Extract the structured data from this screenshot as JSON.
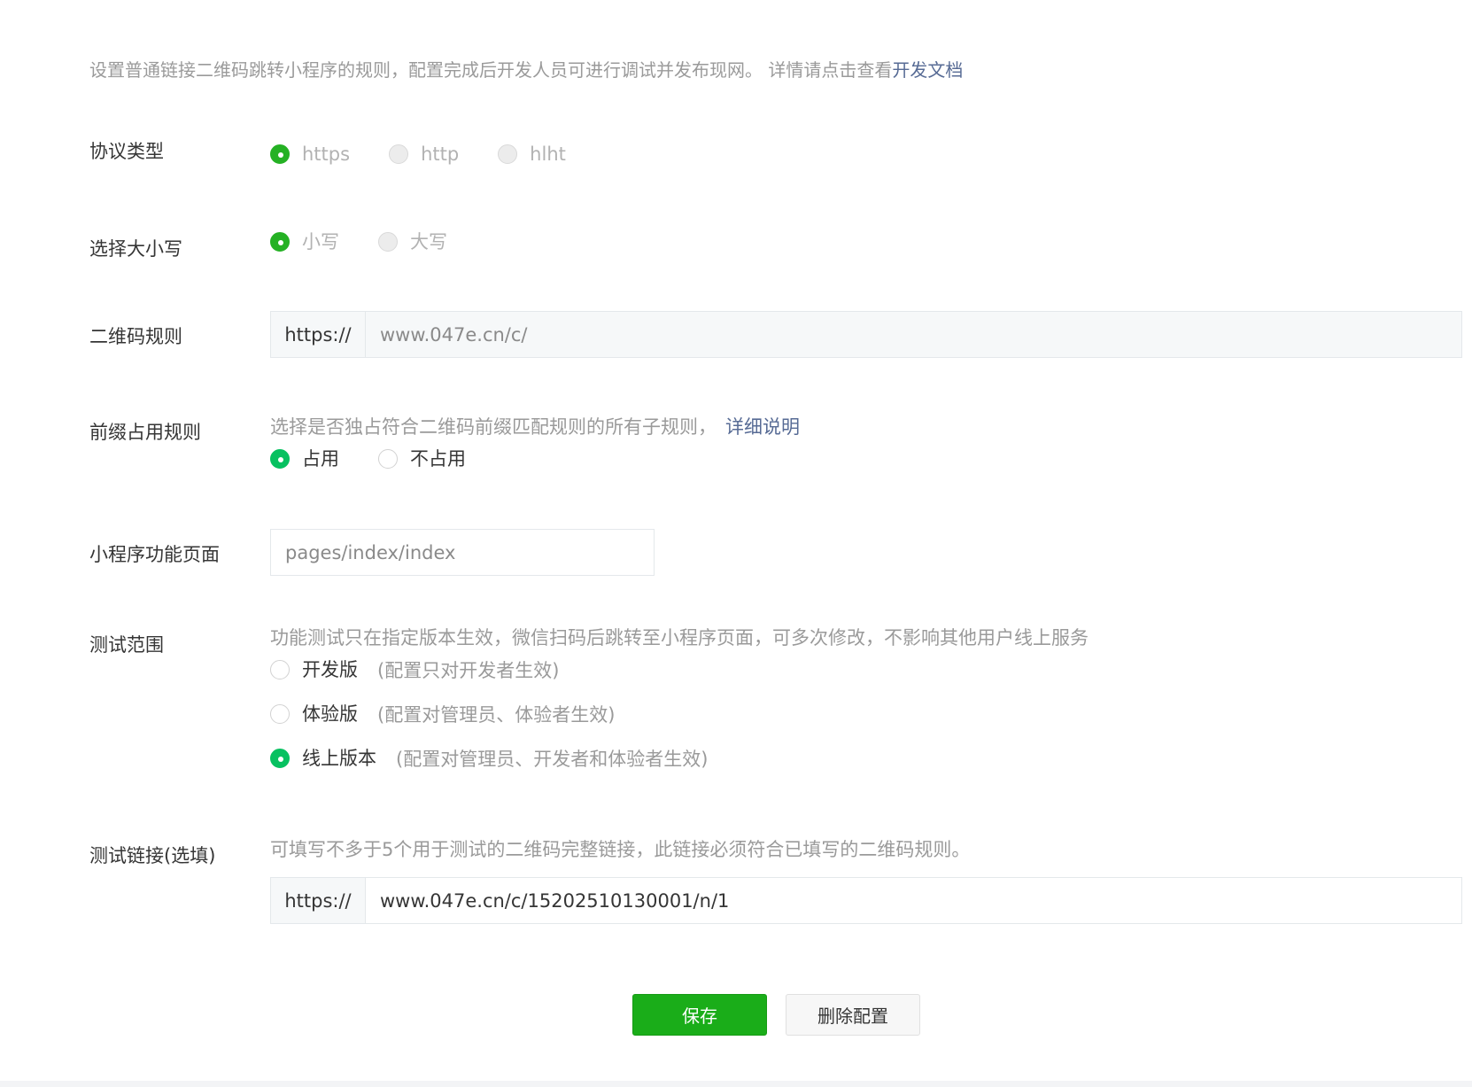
{
  "intro": {
    "text": "设置普通链接二维码跳转小程序的规则，配置完成后开发人员可进行调试并发布现网。 详情请点击查看",
    "link": "开发文档"
  },
  "protocol": {
    "label": "协议类型",
    "options": [
      "https",
      "http",
      "hlht"
    ],
    "selected": "https"
  },
  "letter_case": {
    "label": "选择大小写",
    "options": [
      "小写",
      "大写"
    ],
    "selected": "小写"
  },
  "qr_rule": {
    "label": "二维码规则",
    "prefix": "https://",
    "value": "www.047e.cn/c/"
  },
  "prefix_rule": {
    "label": "前缀占用规则",
    "hint": "选择是否独占符合二维码前缀匹配规则的所有子规则，",
    "hint_link": "详细说明",
    "options": [
      "占用",
      "不占用"
    ],
    "selected": "占用"
  },
  "mini_page": {
    "label": "小程序功能页面",
    "placeholder": "pages/index/index"
  },
  "test_scope": {
    "label": "测试范围",
    "hint": "功能测试只在指定版本生效，微信扫码后跳转至小程序页面，可多次修改，不影响其他用户线上服务",
    "options": [
      {
        "label": "开发版",
        "note": "(配置只对开发者生效)"
      },
      {
        "label": "体验版",
        "note": "(配置对管理员、体验者生效)"
      },
      {
        "label": "线上版本",
        "note": "(配置对管理员、开发者和体验者生效)"
      }
    ],
    "selected": "线上版本"
  },
  "test_link": {
    "label": "测试链接(选填)",
    "hint": "可填写不多于5个用于测试的二维码完整链接，此链接必须符合已填写的二维码规则。",
    "prefix": "https://",
    "value": "www.047e.cn/c/15202510130001/n/1"
  },
  "buttons": {
    "save": "保存",
    "delete": "删除配置"
  },
  "colors": {
    "accent_green": "#07c160",
    "save_green": "#1aad19",
    "link_blue": "#576b95"
  }
}
